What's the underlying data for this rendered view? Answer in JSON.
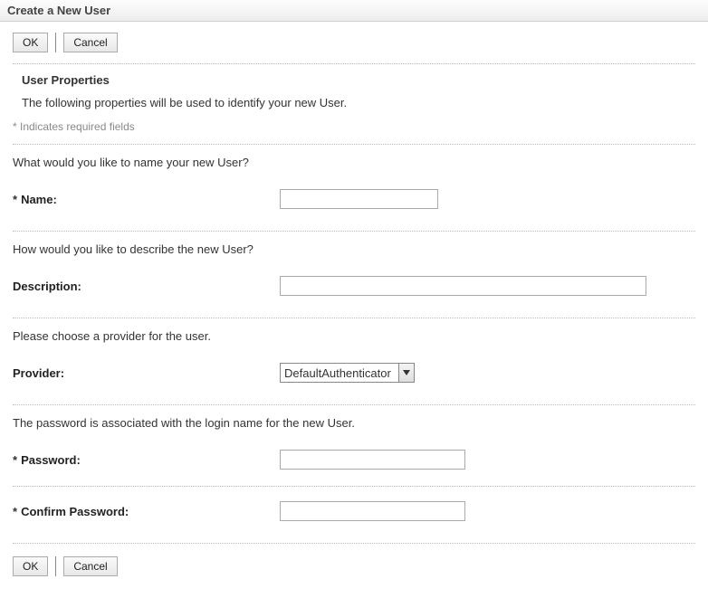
{
  "header": {
    "title": "Create a New User"
  },
  "buttons": {
    "ok": "OK",
    "cancel": "Cancel"
  },
  "section": {
    "title": "User Properties",
    "description": "The following properties will be used to identify your new User.",
    "required_note": "* Indicates required fields"
  },
  "fields": {
    "name": {
      "prompt": "What would you like to name your new User?",
      "label": "Name:",
      "value": ""
    },
    "description": {
      "prompt": "How would you like to describe the new User?",
      "label": "Description:",
      "value": ""
    },
    "provider": {
      "prompt": "Please choose a provider for the user.",
      "label": "Provider:",
      "selected": "DefaultAuthenticator"
    },
    "password_intro": "The password is associated with the login name for the new User.",
    "password": {
      "label": "Password:",
      "value": ""
    },
    "confirm": {
      "label": "Confirm Password:",
      "value": ""
    }
  },
  "asterisk": "*"
}
